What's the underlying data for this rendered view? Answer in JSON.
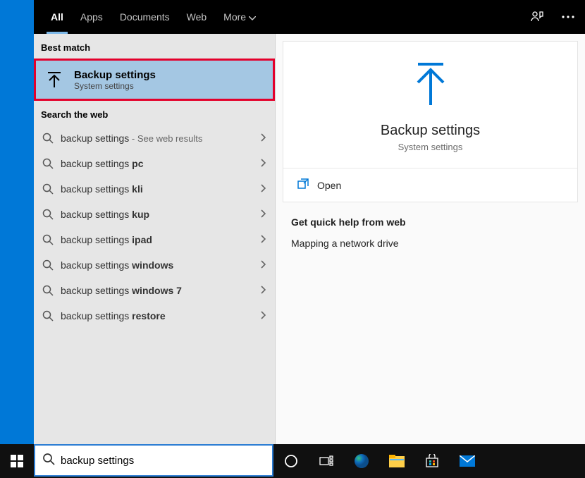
{
  "tabs": {
    "all": "All",
    "apps": "Apps",
    "documents": "Documents",
    "web": "Web",
    "more": "More"
  },
  "sections": {
    "best_match": "Best match",
    "search_web": "Search the web"
  },
  "best_match": {
    "title": "Backup settings",
    "subtitle": "System settings"
  },
  "web_results": [
    {
      "prefix": "backup settings",
      "bold": "",
      "suffix": "See web results"
    },
    {
      "prefix": "backup settings ",
      "bold": "pc",
      "suffix": ""
    },
    {
      "prefix": "backup settings ",
      "bold": "kli",
      "suffix": ""
    },
    {
      "prefix": "backup settings ",
      "bold": "kup",
      "suffix": ""
    },
    {
      "prefix": "backup settings ",
      "bold": "ipad",
      "suffix": ""
    },
    {
      "prefix": "backup settings ",
      "bold": "windows",
      "suffix": ""
    },
    {
      "prefix": "backup settings ",
      "bold": "windows 7",
      "suffix": ""
    },
    {
      "prefix": "backup settings ",
      "bold": "restore",
      "suffix": ""
    }
  ],
  "detail": {
    "title": "Backup settings",
    "subtitle": "System settings",
    "open": "Open",
    "quick_help_hdr": "Get quick help from web",
    "quick_help_items": [
      "Mapping a network drive"
    ]
  },
  "search": {
    "value": "backup settings"
  },
  "colors": {
    "accent": "#0078d7",
    "highlight_border": "#e4002b"
  }
}
